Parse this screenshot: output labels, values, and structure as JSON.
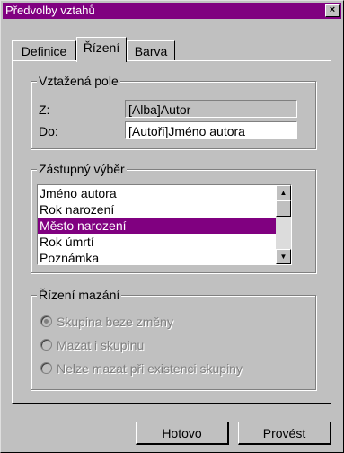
{
  "window": {
    "title": "Předvolby vztahů",
    "close_glyph": "×"
  },
  "tabs": [
    {
      "label": "Definice"
    },
    {
      "label": "Řízení",
      "active": true
    },
    {
      "label": "Barva"
    }
  ],
  "related_fields": {
    "legend": "Vztažená pole",
    "from_label": "Z:",
    "from_value": "[Alba]Autor",
    "to_label": "Do:",
    "to_value": "[Autoři]Jméno autora"
  },
  "substitute": {
    "legend": "Zástupný výběr",
    "items": [
      "Jméno autora",
      "Rok narození",
      "Město narození",
      "Rok úmrtí",
      "Poznámka"
    ],
    "selected": "Město narození"
  },
  "delete_control": {
    "legend": "Řízení mazání",
    "options": [
      {
        "label": "Skupina beze změny",
        "checked": true
      },
      {
        "label": "Mazat i skupinu",
        "checked": false
      },
      {
        "label": "Nelze mazat při existenci skupiny",
        "checked": false
      }
    ]
  },
  "buttons": {
    "ok": "Hotovo",
    "apply": "Provést"
  }
}
